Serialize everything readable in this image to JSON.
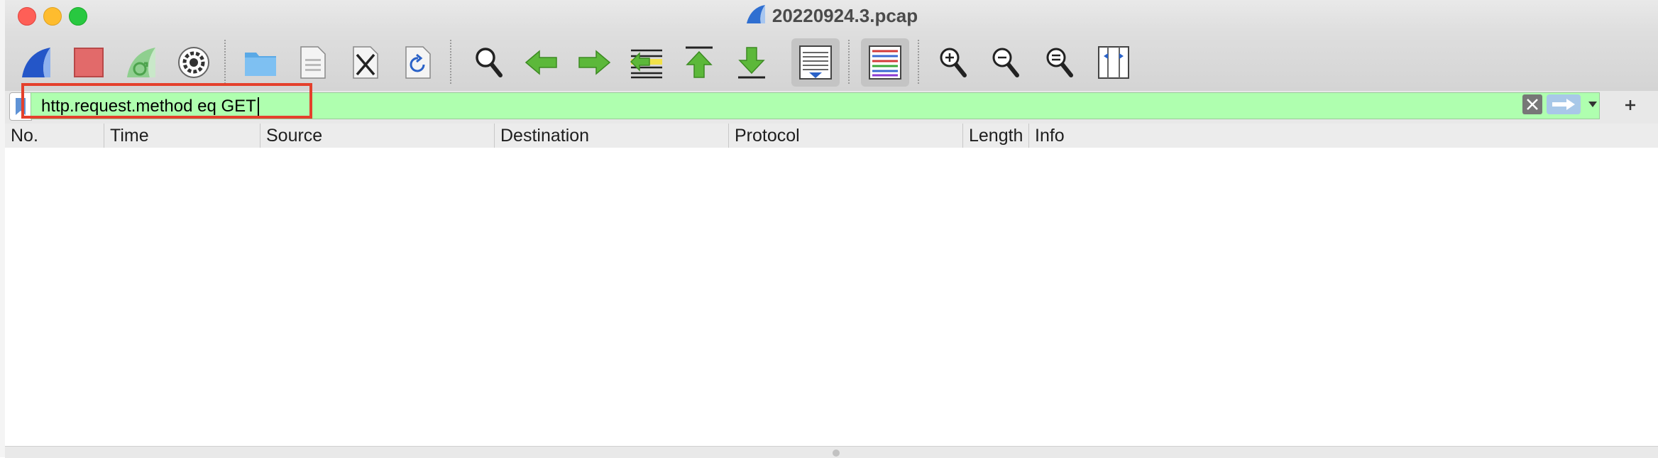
{
  "window": {
    "title": "20220924.3.pcap"
  },
  "toolbar": {
    "buttons": [
      {
        "name": "start-capture",
        "icon": "shark-fin-icon"
      },
      {
        "name": "stop-capture",
        "icon": "stop-square-icon"
      },
      {
        "name": "restart-capture",
        "icon": "restart-fin-icon"
      },
      {
        "name": "capture-options",
        "icon": "gear-icon"
      },
      {
        "name": "open-file",
        "icon": "folder-icon"
      },
      {
        "name": "save-file",
        "icon": "file-icon"
      },
      {
        "name": "close-file",
        "icon": "close-file-icon"
      },
      {
        "name": "reload-file",
        "icon": "reload-icon"
      },
      {
        "name": "find-packet",
        "icon": "magnifier-icon"
      },
      {
        "name": "go-back",
        "icon": "arrow-left-icon"
      },
      {
        "name": "go-forward",
        "icon": "arrow-right-icon"
      },
      {
        "name": "go-to-packet",
        "icon": "go-to-packet-icon"
      },
      {
        "name": "go-first",
        "icon": "arrow-up-first-icon"
      },
      {
        "name": "go-last",
        "icon": "arrow-down-last-icon"
      },
      {
        "name": "autoscroll",
        "icon": "autoscroll-icon"
      },
      {
        "name": "colorize",
        "icon": "colorize-lines-icon"
      },
      {
        "name": "zoom-in",
        "icon": "zoom-in-icon"
      },
      {
        "name": "zoom-out",
        "icon": "zoom-out-icon"
      },
      {
        "name": "normal-size",
        "icon": "zoom-reset-icon"
      },
      {
        "name": "resize-columns",
        "icon": "resize-columns-icon"
      }
    ]
  },
  "filter": {
    "value": "http.request.method eq GET",
    "background": "#afffaf"
  },
  "packet_list": {
    "columns": [
      "No.",
      "Time",
      "Source",
      "Destination",
      "Protocol",
      "Length",
      "Info"
    ],
    "rows": []
  },
  "colors": {
    "highlight": "#e4402c",
    "arrow_green": "#5cb83a",
    "folder_blue": "#5aa9e6"
  }
}
